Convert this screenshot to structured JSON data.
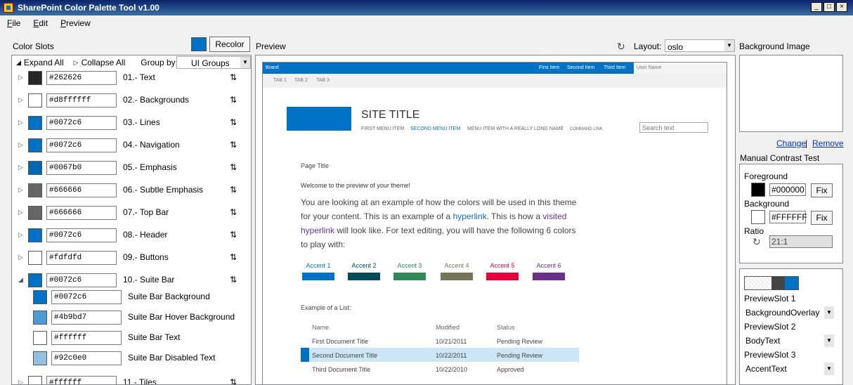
{
  "window": {
    "title": "SharePoint Color Palette Tool v1.00",
    "min": "_",
    "max": "□",
    "close": "×"
  },
  "menu": [
    "File",
    "Edit",
    "Preview"
  ],
  "left": {
    "header": "Color Slots",
    "recolor_label": "Recolor",
    "expand_all": "Expand All",
    "collapse_all": "Collapse All",
    "group_by_label": "Group by:",
    "group_by_value": "UI Groups",
    "rows": [
      {
        "hex": "#262626",
        "name": "01.- Text",
        "color": "#262626"
      },
      {
        "hex": "#d8ffffff",
        "name": "02.- Backgrounds",
        "color": "#ffffff"
      },
      {
        "hex": "#0072c6",
        "name": "03.- Lines",
        "color": "#0072c6"
      },
      {
        "hex": "#0072c6",
        "name": "04.- Navigation",
        "color": "#0072c6"
      },
      {
        "hex": "#0067b0",
        "name": "05.- Emphasis",
        "color": "#0067b0"
      },
      {
        "hex": "#666666",
        "name": "06.- Subtle Emphasis",
        "color": "#666666"
      },
      {
        "hex": "#666666",
        "name": "07.- Top Bar",
        "color": "#666666"
      },
      {
        "hex": "#0072c6",
        "name": "08.- Header",
        "color": "#0072c6"
      },
      {
        "hex": "#fdfdfd",
        "name": "09.- Buttons",
        "color": "#fdfdfd"
      },
      {
        "hex": "#0072c6",
        "name": "10.- Suite Bar",
        "color": "#0072c6"
      }
    ],
    "subrows": [
      {
        "hex": "#0072c6",
        "name": "Suite Bar Background",
        "color": "#0072c6"
      },
      {
        "hex": "#4b9bd7",
        "name": "Suite Bar Hover Background",
        "color": "#4b9bd7"
      },
      {
        "hex": "#ffffff",
        "name": "Suite Bar Text",
        "color": "#ffffff"
      },
      {
        "hex": "#92c0e0",
        "name": "Suite Bar Disabled Text",
        "color": "#92c0e0"
      }
    ],
    "last_row": {
      "hex": "#ffffff",
      "name": "11.- Tiles",
      "color": "#ffffff"
    }
  },
  "preview": {
    "header": "Preview",
    "layout_label": "Layout:",
    "layout_value": "oslo",
    "site": {
      "brand": "Brand",
      "suite_items": [
        "First Item",
        "Second Item",
        "Third Item"
      ],
      "user_name": "User Name",
      "tabs": [
        "TAB 1",
        "TAB 2",
        "TAB 3"
      ],
      "site_title": "SITE TITLE",
      "nav": [
        "FIRST MENU ITEM",
        "SECOND MENU ITEM",
        "MENU ITEM WITH A REALLY LONG NAME",
        "COMMAND LINK"
      ],
      "search_placeholder": "Search text",
      "page_title": "Page Title",
      "welcome": "Welcome to the preview of your theme!",
      "body_1": "You are looking at an example of how the colors will be used in this theme for your content. This is an example of a ",
      "hyperlink": "hyperlink",
      "body_2": ". This is how a ",
      "visited": "visited hyperlink",
      "body_3": " will look like. For text editing, you will have the following 6 colors to play with:",
      "accents": [
        {
          "label": "Accent 1",
          "color": "#0072c6"
        },
        {
          "label": "Accent 2",
          "color": "#004b5a"
        },
        {
          "label": "Accent 3",
          "color": "#2e8b57"
        },
        {
          "label": "Accent 4",
          "color": "#767456"
        },
        {
          "label": "Accent 5",
          "color": "#e8003c"
        },
        {
          "label": "Accent 6",
          "color": "#6b2f8a"
        }
      ],
      "list_title": "Example of a List:",
      "list_headers": [
        "Name",
        "Modified",
        "Status"
      ],
      "list_rows": [
        [
          "First Document Title",
          "10/21/2011",
          "Pending Review"
        ],
        [
          "Second Document Title",
          "10/22/2011",
          "Pending Review"
        ],
        [
          "Third Document Title",
          "10/22/2010",
          "Approved"
        ]
      ]
    }
  },
  "right": {
    "bg_header": "Background Image",
    "change": "Change",
    "separator": "|",
    "remove": "Remove",
    "contrast_header": "Manual Contrast Test",
    "foreground_label": "Foreground",
    "foreground_value": "#000000",
    "background_label": "Background",
    "background_value": "#FFFFFF",
    "fix": "Fix",
    "ratio_label": "Ratio",
    "ratio_value": "21:1",
    "slot1_label": "PreviewSlot 1",
    "slot1_value": "BackgroundOverlay",
    "slot2_label": "PreviewSlot 2",
    "slot2_value": "BodyText",
    "slot3_label": "PreviewSlot 3",
    "slot3_value": "AccentText"
  }
}
